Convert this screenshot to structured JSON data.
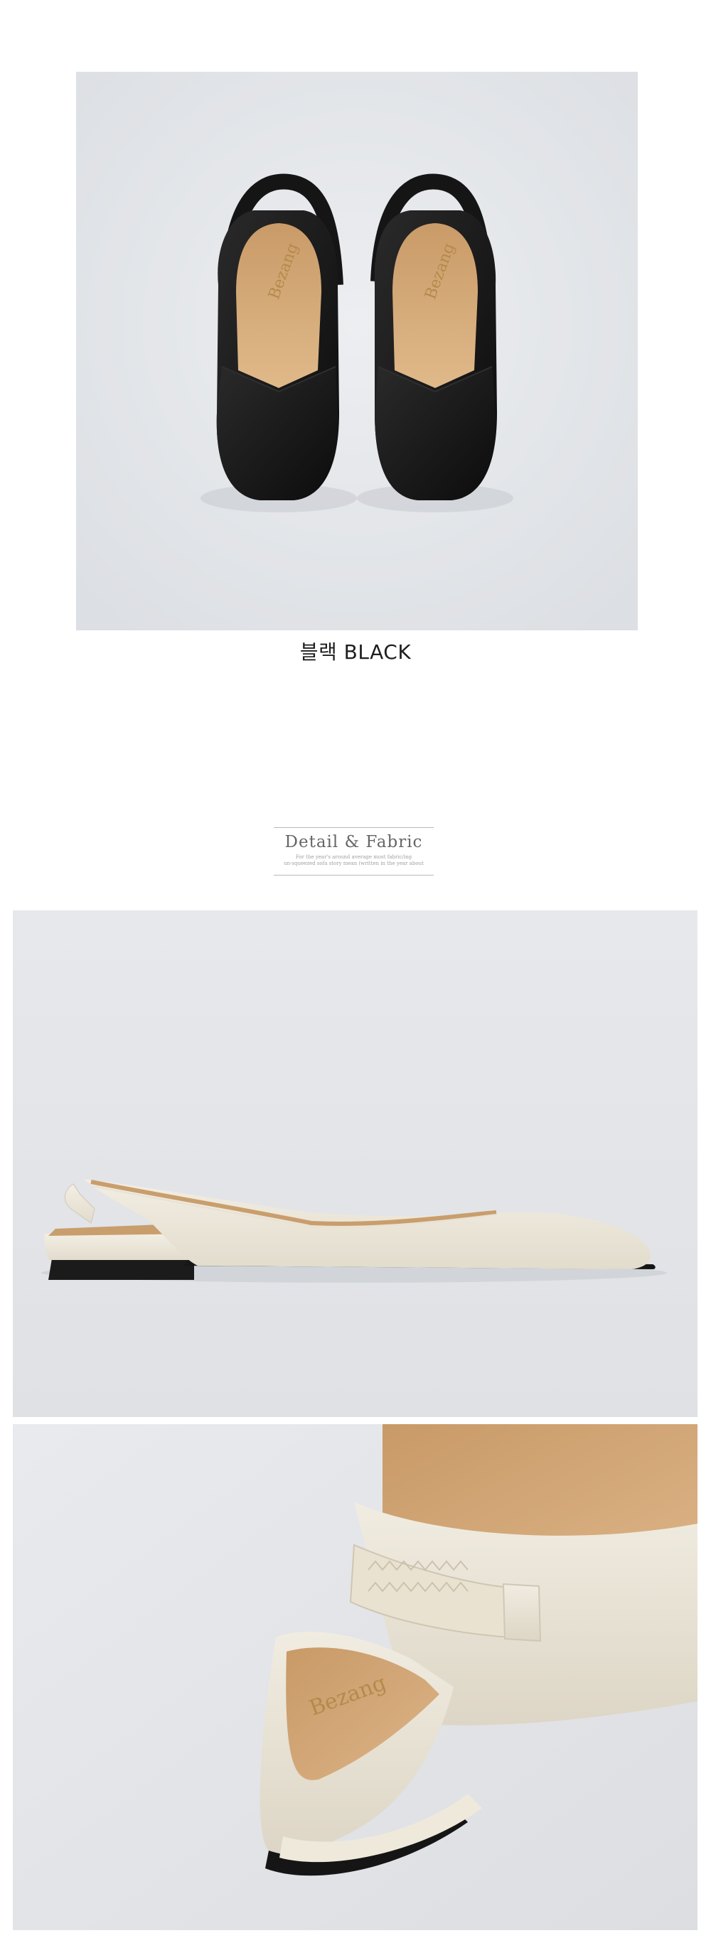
{
  "product_images": {
    "black_shoes_alt": "black slingback flats top view",
    "side_view_alt": "ivory slingback flat side view",
    "detail_view_alt": "ivory slingback heel strap close-up"
  },
  "color_option": {
    "label": "블랙 BLACK"
  },
  "detail_section": {
    "title": "Detail & Fabric",
    "subtitle_line1": "For the year's around average most fabric/ing",
    "subtitle_line2": "un-squeezed sofa story mean (written in the year about"
  },
  "colors": {
    "shoe_black": "#141414",
    "lining_tan": "#d2a877",
    "shoe_ivory": "#ece6d8",
    "sole_black": "#1a1a1a",
    "backdrop": "#e4e6ea"
  }
}
